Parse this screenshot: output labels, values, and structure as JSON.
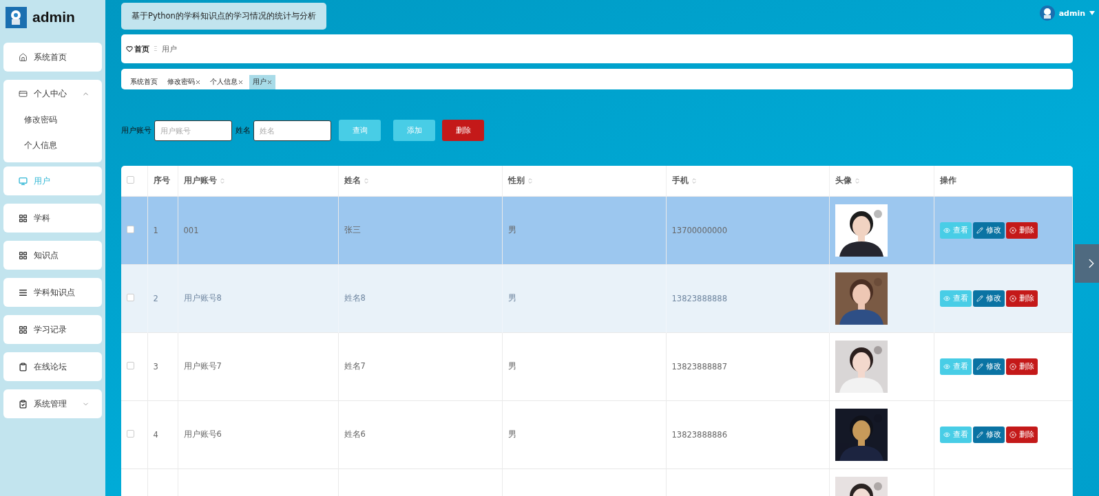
{
  "brand": {
    "title": "admin"
  },
  "sidebar": {
    "items": [
      {
        "label": "系统首页",
        "selected": false
      },
      {
        "label": "个人中心",
        "selected": false,
        "expanded": true,
        "children": [
          {
            "label": "修改密码",
            "selected": false
          },
          {
            "label": "个人信息",
            "selected": false
          }
        ]
      },
      {
        "label": "用户",
        "selected": true
      },
      {
        "label": "学科",
        "selected": false
      },
      {
        "label": "知识点",
        "selected": false
      },
      {
        "label": "学科知识点",
        "selected": false
      },
      {
        "label": "学习记录",
        "selected": false
      },
      {
        "label": "在线论坛",
        "selected": false
      },
      {
        "label": "系统管理",
        "selected": false,
        "expanded": false
      }
    ]
  },
  "header": {
    "title": "基于Python的学科知识点的学习情况的统计与分析",
    "user": "admin"
  },
  "breadcrumb": {
    "home": "首页",
    "separator": "Ξ",
    "current": "用户"
  },
  "tags": [
    {
      "label": "系统首页",
      "closable": false,
      "selected": false
    },
    {
      "label": "修改密码",
      "closable": true,
      "selected": false
    },
    {
      "label": "个人信息",
      "closable": true,
      "selected": false
    },
    {
      "label": "用户",
      "closable": true,
      "selected": true
    }
  ],
  "search": {
    "fields": [
      {
        "label": "用户账号",
        "placeholder": "用户账号"
      },
      {
        "label": "姓名",
        "placeholder": "姓名"
      }
    ],
    "buttons": [
      {
        "label": "查询",
        "kind": "search"
      },
      {
        "label": "添加",
        "kind": "add"
      },
      {
        "label": "删除",
        "kind": "delete"
      }
    ]
  },
  "table": {
    "all_checked": false,
    "columns": [
      {
        "label": "序号",
        "sortable": false
      },
      {
        "label": "用户账号",
        "sortable": true
      },
      {
        "label": "姓名",
        "sortable": true
      },
      {
        "label": "性别",
        "sortable": true
      },
      {
        "label": "手机",
        "sortable": true
      },
      {
        "label": "头像",
        "sortable": true
      },
      {
        "label": "操作",
        "sortable": false
      }
    ],
    "rows": [
      {
        "selected": true,
        "hovered": false,
        "checked": false,
        "index": "1",
        "account": "001",
        "name": "张三",
        "gender": "男",
        "phone": "13700000000",
        "avatar": {
          "kind": "picture"
        },
        "actions": [
          "查看",
          "修改",
          "删除"
        ]
      },
      {
        "selected": false,
        "hovered": true,
        "checked": false,
        "index": "2",
        "account": "用户账号8",
        "name": "姓名8",
        "gender": "男",
        "phone": "13823888888",
        "avatar": {
          "kind": "picture"
        },
        "actions": [
          "查看",
          "修改",
          "删除"
        ]
      },
      {
        "selected": false,
        "hovered": false,
        "checked": false,
        "index": "3",
        "account": "用户账号7",
        "name": "姓名7",
        "gender": "男",
        "phone": "13823888887",
        "avatar": {
          "kind": "picture"
        },
        "actions": [
          "查看",
          "修改",
          "删除"
        ]
      },
      {
        "selected": false,
        "hovered": false,
        "checked": false,
        "index": "4",
        "account": "用户账号6",
        "name": "姓名6",
        "gender": "男",
        "phone": "13823888886",
        "avatar": {
          "kind": "picture"
        },
        "actions": [
          "查看",
          "修改",
          "删除"
        ]
      },
      {
        "selected": false,
        "hovered": false,
        "avatar": {
          "kind": "picture"
        }
      }
    ]
  }
}
